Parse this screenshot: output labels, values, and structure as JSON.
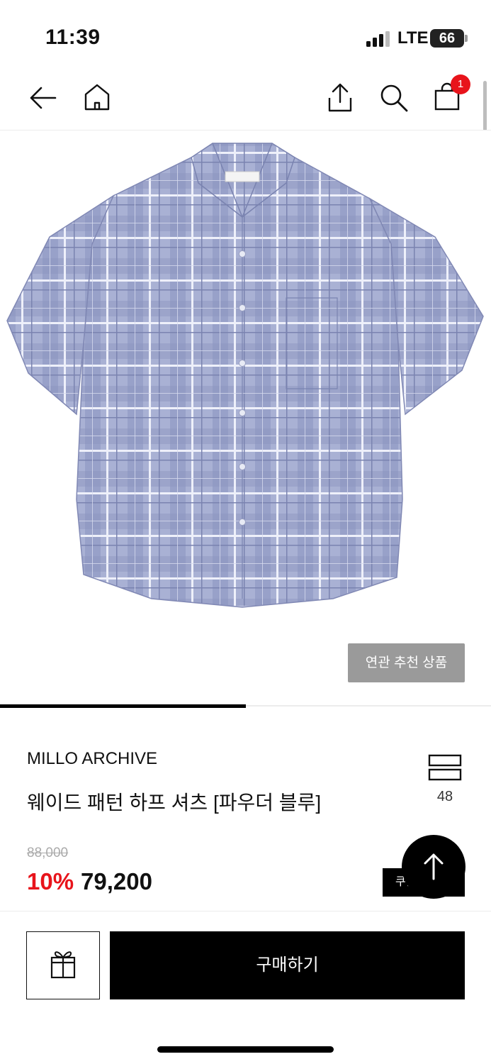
{
  "status_bar": {
    "time": "11:39",
    "network": "LTE",
    "battery": "66"
  },
  "nav": {
    "back_icon": "arrow-left-icon",
    "home_icon": "home-icon",
    "share_icon": "share-icon",
    "search_icon": "search-icon",
    "cart_icon": "shopping-bag-icon",
    "cart_count": "1"
  },
  "gallery": {
    "image_alt": "blue plaid short-sleeve shirt",
    "related_button": "연관 추천 상품",
    "progress": 0.5
  },
  "product": {
    "brand": "MILLO ARCHIVE",
    "name": "웨이드 패턴 하프 셔츠 [파우더 블루]",
    "like_count": "48",
    "original_price": "88,000",
    "discount": "10%",
    "price": "79,200",
    "coupon_button": "쿠폰"
  },
  "actions": {
    "gift_icon": "gift-icon",
    "buy_button": "구매하기",
    "scroll_top_icon": "arrow-up-icon"
  },
  "colors": {
    "accent_red": "#e8141b",
    "black": "#000000",
    "related_gray": "#9a9a9a"
  }
}
